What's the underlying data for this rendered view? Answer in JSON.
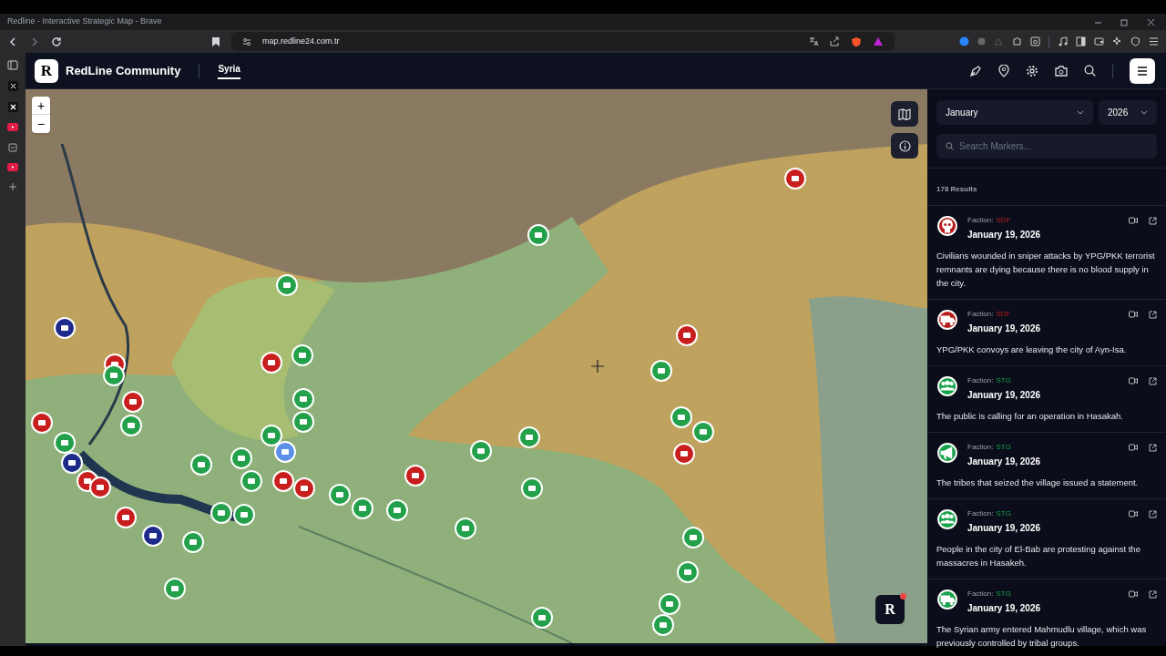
{
  "window": {
    "title": "Redline - Interactive Strategic Map - Brave"
  },
  "address_bar": {
    "url": "map.redline24.com.tr"
  },
  "header": {
    "logo_letter": "R",
    "brand": "RedLine Community",
    "tabs": [
      {
        "label": "Syria",
        "selected": true
      }
    ]
  },
  "map": {
    "zoom_in": "+",
    "zoom_out": "−",
    "badge_letter": "R"
  },
  "filters": {
    "month": "January",
    "year": "2026",
    "search": {
      "placeholder": "Search Markers..."
    },
    "results": "178 Results"
  },
  "events": [
    {
      "kind": "skull",
      "faction_label": "Faction:",
      "faction": "SDF",
      "color": "#b91c1c",
      "date": "January 19, 2026",
      "text": "Civilians wounded in sniper attacks by YPG/PKK terrorist remnants are dying because there is no blood supply in the city."
    },
    {
      "kind": "truck",
      "faction_label": "Faction:",
      "faction": "SDF",
      "color": "#b91c1c",
      "date": "January 19, 2026",
      "text": "YPG/PKK convoys are leaving the city of Ayn-Isa."
    },
    {
      "kind": "people",
      "faction_label": "Faction:",
      "faction": "STG",
      "color": "#16a34a",
      "date": "January 19, 2026",
      "text": "The public is calling for an operation in Hasakah."
    },
    {
      "kind": "megaphone",
      "faction_label": "Faction:",
      "faction": "STG",
      "color": "#16a34a",
      "date": "January 19, 2026",
      "text": "The tribes that seized the village issued a statement."
    },
    {
      "kind": "people",
      "faction_label": "Faction:",
      "faction": "STG",
      "color": "#16a34a",
      "date": "January 19, 2026",
      "text": "People in the city of El-Bab are protesting against the massacres in Hasakeh."
    },
    {
      "kind": "truck",
      "faction_label": "Faction:",
      "faction": "STG",
      "color": "#16a34a",
      "date": "January 19, 2026",
      "text": "The Syrian army entered Mahmudlu village, which was previously controlled by tribal groups."
    }
  ]
}
